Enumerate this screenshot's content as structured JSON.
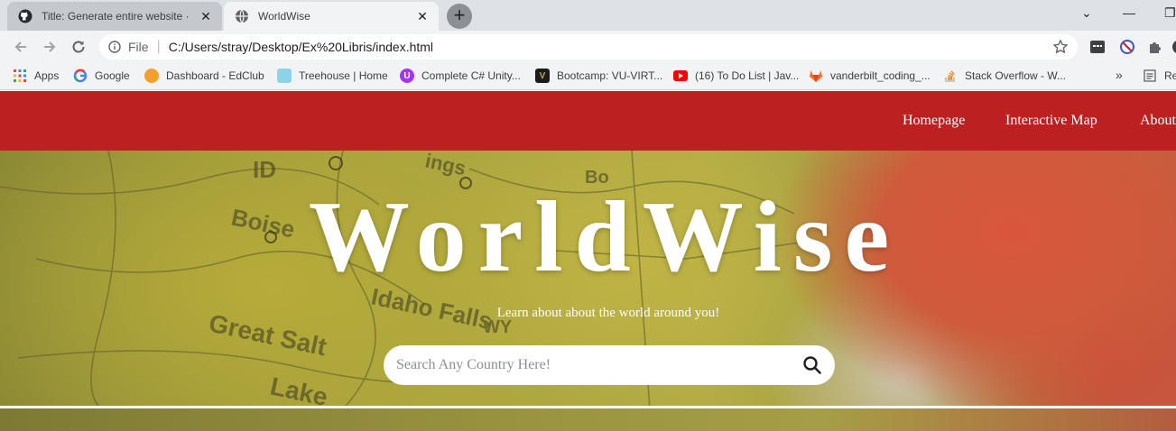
{
  "browser": {
    "tabs": [
      {
        "title": "Title: Generate entire website · Is",
        "icon": "github-icon",
        "active": false
      },
      {
        "title": "WorldWise",
        "icon": "globe-icon",
        "active": true
      }
    ],
    "new_tab": "+",
    "close": "✕",
    "window_controls": {
      "menu": "⌄",
      "minimize": "—",
      "restore": "❐"
    },
    "address": {
      "scheme": "File",
      "url": "C:/Users/stray/Desktop/Ex%20Libris/index.html"
    },
    "bookmarks": [
      {
        "label": "Apps",
        "icon": "apps-grid-icon"
      },
      {
        "label": "Google",
        "icon": "google-icon"
      },
      {
        "label": "Dashboard - EdClub",
        "icon": "edclub-icon"
      },
      {
        "label": "Treehouse | Home",
        "icon": "treehouse-icon"
      },
      {
        "label": "Complete C# Unity...",
        "icon": "udemy-icon"
      },
      {
        "label": "Bootcamp: VU-VIRT...",
        "icon": "vanderbilt-icon"
      },
      {
        "label": "(16) To Do List | Jav...",
        "icon": "youtube-icon"
      },
      {
        "label": "vanderbilt_coding_...",
        "icon": "gitlab-icon"
      },
      {
        "label": "Stack Overflow - W...",
        "icon": "stackoverflow-icon"
      }
    ],
    "bookmarks_overflow": "»",
    "reading_list_label": "Re"
  },
  "site": {
    "nav": [
      "Homepage",
      "Interactive Map",
      "About"
    ],
    "brand": "WorldWise",
    "tagline": "Learn about about the world around you!",
    "search": {
      "placeholder": "Search Any Country Here!"
    },
    "map_labels": [
      "ID",
      "Boise",
      "Idaho Falls",
      "Great Salt",
      "Lake",
      "ings",
      "WY",
      "Bo"
    ]
  },
  "colors": {
    "nav_bg": "#bd2020",
    "accent_white": "#ffffff"
  }
}
